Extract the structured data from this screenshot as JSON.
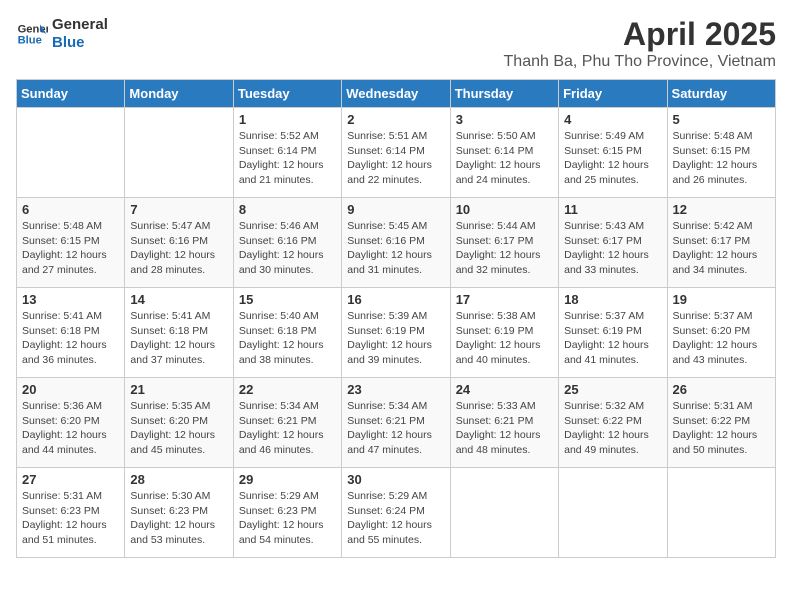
{
  "header": {
    "logo_line1": "General",
    "logo_line2": "Blue",
    "month": "April 2025",
    "location": "Thanh Ba, Phu Tho Province, Vietnam"
  },
  "weekdays": [
    "Sunday",
    "Monday",
    "Tuesday",
    "Wednesday",
    "Thursday",
    "Friday",
    "Saturday"
  ],
  "weeks": [
    [
      {
        "day": "",
        "sunrise": "",
        "sunset": "",
        "daylight": ""
      },
      {
        "day": "",
        "sunrise": "",
        "sunset": "",
        "daylight": ""
      },
      {
        "day": "1",
        "sunrise": "Sunrise: 5:52 AM",
        "sunset": "Sunset: 6:14 PM",
        "daylight": "Daylight: 12 hours and 21 minutes."
      },
      {
        "day": "2",
        "sunrise": "Sunrise: 5:51 AM",
        "sunset": "Sunset: 6:14 PM",
        "daylight": "Daylight: 12 hours and 22 minutes."
      },
      {
        "day": "3",
        "sunrise": "Sunrise: 5:50 AM",
        "sunset": "Sunset: 6:14 PM",
        "daylight": "Daylight: 12 hours and 24 minutes."
      },
      {
        "day": "4",
        "sunrise": "Sunrise: 5:49 AM",
        "sunset": "Sunset: 6:15 PM",
        "daylight": "Daylight: 12 hours and 25 minutes."
      },
      {
        "day": "5",
        "sunrise": "Sunrise: 5:48 AM",
        "sunset": "Sunset: 6:15 PM",
        "daylight": "Daylight: 12 hours and 26 minutes."
      }
    ],
    [
      {
        "day": "6",
        "sunrise": "Sunrise: 5:48 AM",
        "sunset": "Sunset: 6:15 PM",
        "daylight": "Daylight: 12 hours and 27 minutes."
      },
      {
        "day": "7",
        "sunrise": "Sunrise: 5:47 AM",
        "sunset": "Sunset: 6:16 PM",
        "daylight": "Daylight: 12 hours and 28 minutes."
      },
      {
        "day": "8",
        "sunrise": "Sunrise: 5:46 AM",
        "sunset": "Sunset: 6:16 PM",
        "daylight": "Daylight: 12 hours and 30 minutes."
      },
      {
        "day": "9",
        "sunrise": "Sunrise: 5:45 AM",
        "sunset": "Sunset: 6:16 PM",
        "daylight": "Daylight: 12 hours and 31 minutes."
      },
      {
        "day": "10",
        "sunrise": "Sunrise: 5:44 AM",
        "sunset": "Sunset: 6:17 PM",
        "daylight": "Daylight: 12 hours and 32 minutes."
      },
      {
        "day": "11",
        "sunrise": "Sunrise: 5:43 AM",
        "sunset": "Sunset: 6:17 PM",
        "daylight": "Daylight: 12 hours and 33 minutes."
      },
      {
        "day": "12",
        "sunrise": "Sunrise: 5:42 AM",
        "sunset": "Sunset: 6:17 PM",
        "daylight": "Daylight: 12 hours and 34 minutes."
      }
    ],
    [
      {
        "day": "13",
        "sunrise": "Sunrise: 5:41 AM",
        "sunset": "Sunset: 6:18 PM",
        "daylight": "Daylight: 12 hours and 36 minutes."
      },
      {
        "day": "14",
        "sunrise": "Sunrise: 5:41 AM",
        "sunset": "Sunset: 6:18 PM",
        "daylight": "Daylight: 12 hours and 37 minutes."
      },
      {
        "day": "15",
        "sunrise": "Sunrise: 5:40 AM",
        "sunset": "Sunset: 6:18 PM",
        "daylight": "Daylight: 12 hours and 38 minutes."
      },
      {
        "day": "16",
        "sunrise": "Sunrise: 5:39 AM",
        "sunset": "Sunset: 6:19 PM",
        "daylight": "Daylight: 12 hours and 39 minutes."
      },
      {
        "day": "17",
        "sunrise": "Sunrise: 5:38 AM",
        "sunset": "Sunset: 6:19 PM",
        "daylight": "Daylight: 12 hours and 40 minutes."
      },
      {
        "day": "18",
        "sunrise": "Sunrise: 5:37 AM",
        "sunset": "Sunset: 6:19 PM",
        "daylight": "Daylight: 12 hours and 41 minutes."
      },
      {
        "day": "19",
        "sunrise": "Sunrise: 5:37 AM",
        "sunset": "Sunset: 6:20 PM",
        "daylight": "Daylight: 12 hours and 43 minutes."
      }
    ],
    [
      {
        "day": "20",
        "sunrise": "Sunrise: 5:36 AM",
        "sunset": "Sunset: 6:20 PM",
        "daylight": "Daylight: 12 hours and 44 minutes."
      },
      {
        "day": "21",
        "sunrise": "Sunrise: 5:35 AM",
        "sunset": "Sunset: 6:20 PM",
        "daylight": "Daylight: 12 hours and 45 minutes."
      },
      {
        "day": "22",
        "sunrise": "Sunrise: 5:34 AM",
        "sunset": "Sunset: 6:21 PM",
        "daylight": "Daylight: 12 hours and 46 minutes."
      },
      {
        "day": "23",
        "sunrise": "Sunrise: 5:34 AM",
        "sunset": "Sunset: 6:21 PM",
        "daylight": "Daylight: 12 hours and 47 minutes."
      },
      {
        "day": "24",
        "sunrise": "Sunrise: 5:33 AM",
        "sunset": "Sunset: 6:21 PM",
        "daylight": "Daylight: 12 hours and 48 minutes."
      },
      {
        "day": "25",
        "sunrise": "Sunrise: 5:32 AM",
        "sunset": "Sunset: 6:22 PM",
        "daylight": "Daylight: 12 hours and 49 minutes."
      },
      {
        "day": "26",
        "sunrise": "Sunrise: 5:31 AM",
        "sunset": "Sunset: 6:22 PM",
        "daylight": "Daylight: 12 hours and 50 minutes."
      }
    ],
    [
      {
        "day": "27",
        "sunrise": "Sunrise: 5:31 AM",
        "sunset": "Sunset: 6:23 PM",
        "daylight": "Daylight: 12 hours and 51 minutes."
      },
      {
        "day": "28",
        "sunrise": "Sunrise: 5:30 AM",
        "sunset": "Sunset: 6:23 PM",
        "daylight": "Daylight: 12 hours and 53 minutes."
      },
      {
        "day": "29",
        "sunrise": "Sunrise: 5:29 AM",
        "sunset": "Sunset: 6:23 PM",
        "daylight": "Daylight: 12 hours and 54 minutes."
      },
      {
        "day": "30",
        "sunrise": "Sunrise: 5:29 AM",
        "sunset": "Sunset: 6:24 PM",
        "daylight": "Daylight: 12 hours and 55 minutes."
      },
      {
        "day": "",
        "sunrise": "",
        "sunset": "",
        "daylight": ""
      },
      {
        "day": "",
        "sunrise": "",
        "sunset": "",
        "daylight": ""
      },
      {
        "day": "",
        "sunrise": "",
        "sunset": "",
        "daylight": ""
      }
    ]
  ]
}
